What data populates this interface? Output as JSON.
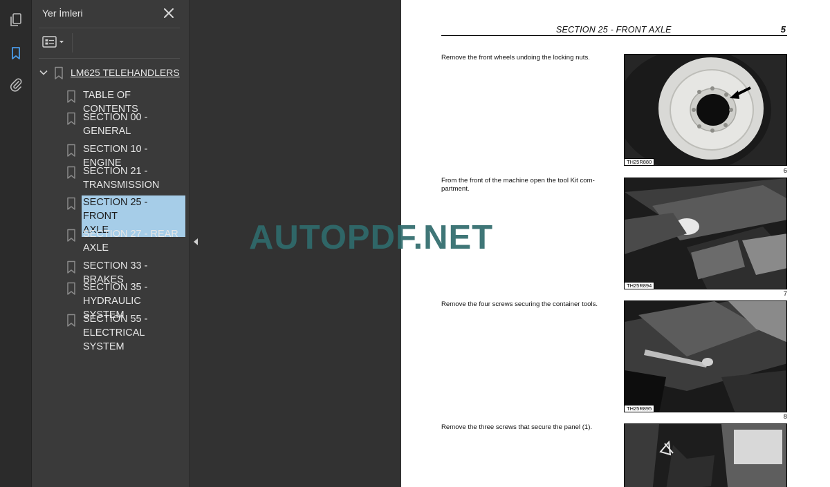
{
  "panel": {
    "title": "Yer İmleri",
    "root_label": "LM625 TELEHANDLERS",
    "bookmarks": [
      {
        "label": "TABLE OF CONTENTS"
      },
      {
        "label": "SECTION 00 -\nGENERAL"
      },
      {
        "label": "SECTION 10 - ENGINE"
      },
      {
        "label": "SECTION 21 -\nTRANSMISSION"
      },
      {
        "label": "SECTION 25 - FRONT\nAXLE"
      },
      {
        "label": "SECTION 27 - REAR\nAXLE"
      },
      {
        "label": "SECTION 33 - BRAKES"
      },
      {
        "label": "SECTION 35 -\nHYDRAULIC SYSTEM"
      },
      {
        "label": "SECTION 55 -\nELECTRICAL SYSTEM"
      }
    ],
    "selected_index": 4
  },
  "page": {
    "header_section": "SECTION 25 - FRONT AXLE",
    "page_number": "5",
    "steps": [
      {
        "text": "Remove the front wheels undoing the locking nuts.",
        "photo_ref": "TH25R880",
        "fig": "6"
      },
      {
        "text": "From the front of the machine open the tool Kit com-\npartment.",
        "photo_ref": "TH25R894",
        "fig": "7"
      },
      {
        "text": "Remove the four screws securing the container tools.",
        "photo_ref": "TH25R895",
        "fig": "8"
      },
      {
        "text": "Remove the three screws that secure the panel (1).",
        "photo_ref": "",
        "fig": ""
      }
    ]
  },
  "watermark": "AUTOPDF.NET",
  "colors": {
    "selection": "#a6cde8",
    "rail_active": "#4a9be8",
    "watermark": "#2f6b6c"
  },
  "icons": {
    "rail": [
      "pages-icon",
      "bookmark-icon",
      "attachment-icon"
    ],
    "panel_close": "close-icon",
    "options": "options-icon",
    "collapse": "collapse-left-icon"
  }
}
